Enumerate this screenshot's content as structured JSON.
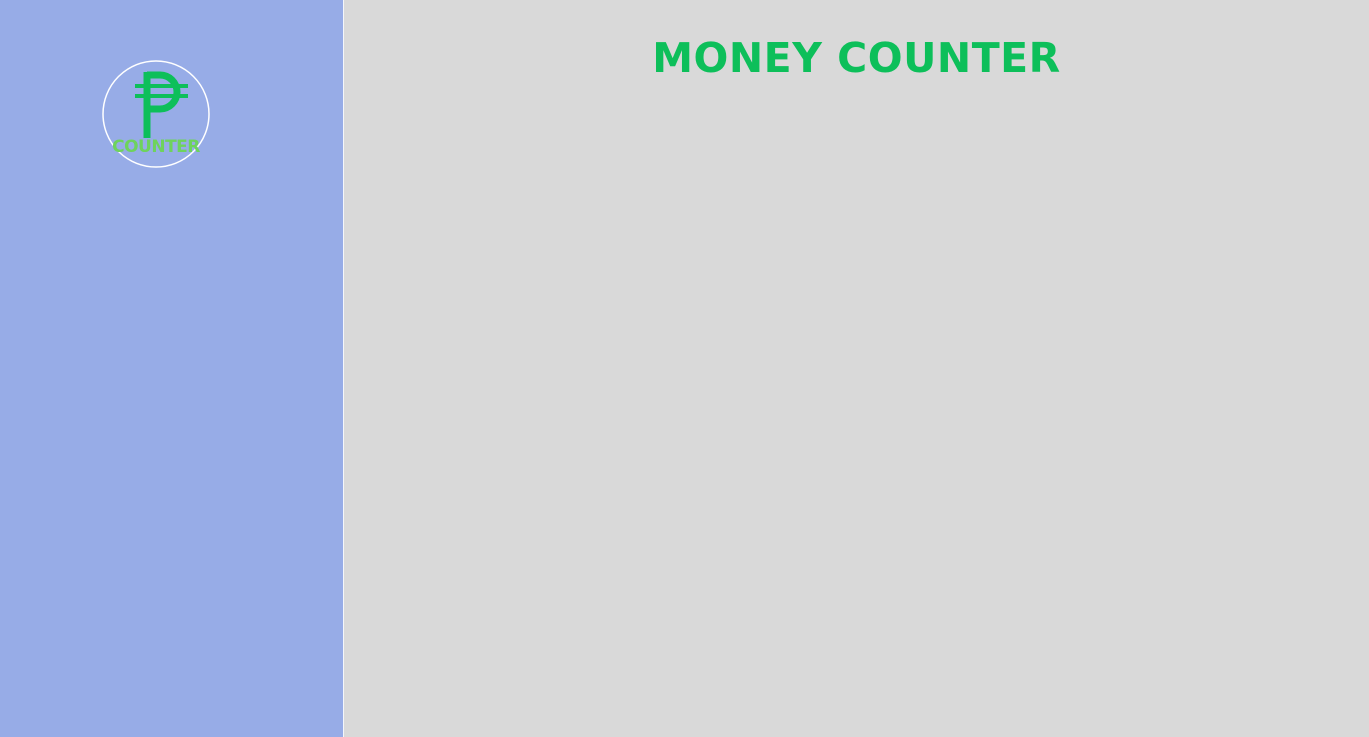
{
  "sidebar": {
    "logo": {
      "symbol": "₱",
      "text": "COUNTER",
      "icon": "peso-sign-icon",
      "symbol_color": "#0dbf5a",
      "text_color": "#6ed35c",
      "ring_color": "#ffffff"
    },
    "background_color": "#97ace7"
  },
  "main": {
    "title": "MONEY COUNTER",
    "title_color": "#0dbf5a",
    "background_color": "#d9d9d9"
  }
}
